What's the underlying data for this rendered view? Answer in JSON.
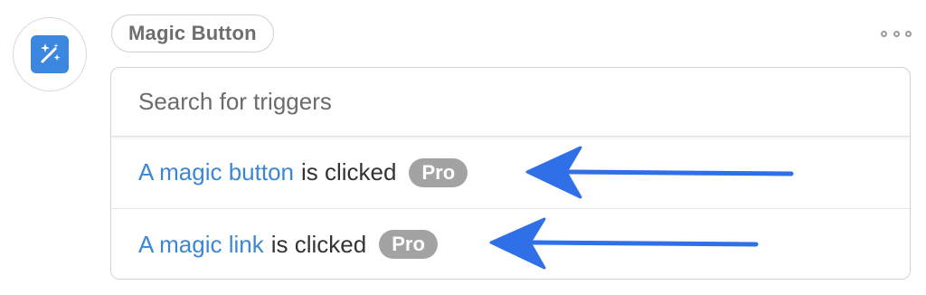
{
  "header": {
    "title": "Magic Button",
    "app_icon": "magic-wand-icon",
    "more_icon": "more-options-icon"
  },
  "search": {
    "placeholder": "Search for triggers",
    "value": ""
  },
  "triggers": [
    {
      "link_text": "A magic button",
      "rest_text": "is clicked",
      "badge": "Pro"
    },
    {
      "link_text": "A magic link",
      "rest_text": "is clicked",
      "badge": "Pro"
    }
  ],
  "colors": {
    "accent": "#3b87d6",
    "badge": "#a3a3a3",
    "annotation_arrow": "#2f6fe8"
  }
}
